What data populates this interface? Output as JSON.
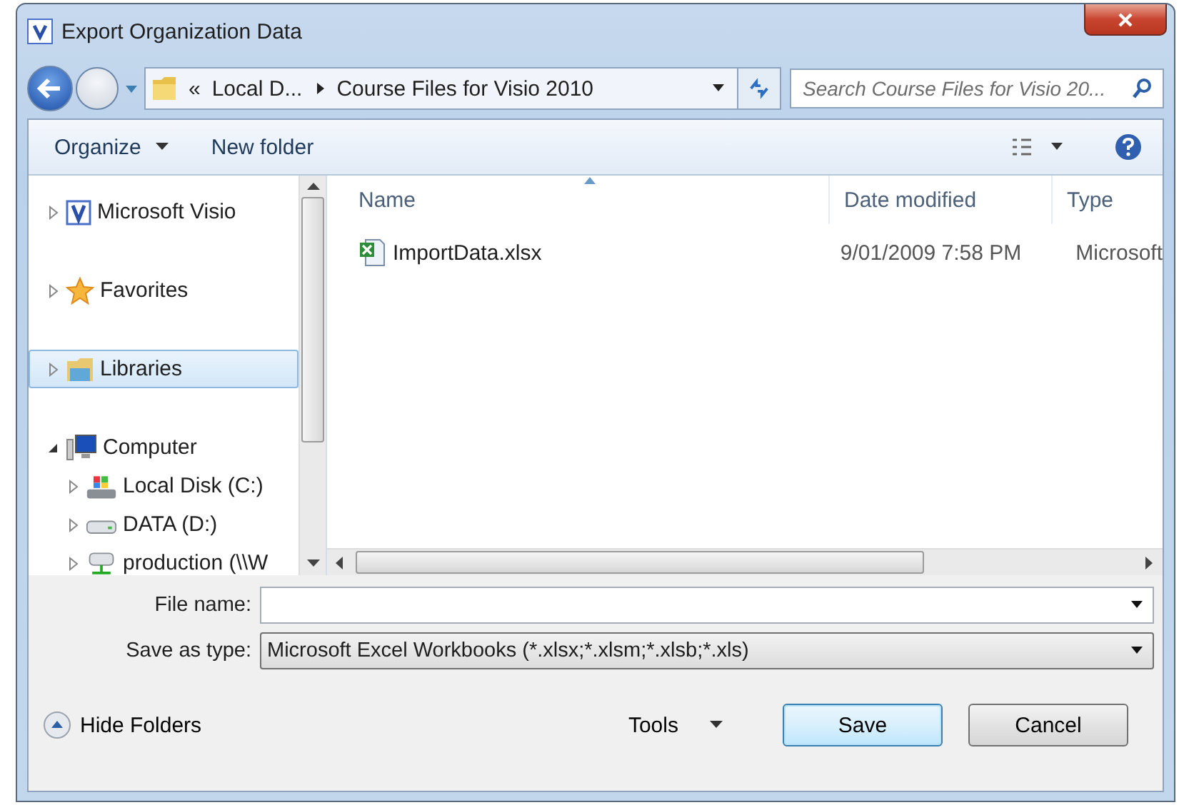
{
  "window": {
    "title": "Export Organization Data"
  },
  "address_bar": {
    "overflow": "«",
    "segments": [
      "Local D...",
      "Course Files for Visio 2010"
    ]
  },
  "search": {
    "placeholder": "Search Course Files for Visio 20..."
  },
  "toolbar": {
    "organize": "Organize",
    "new_folder": "New folder"
  },
  "sidebar": {
    "items": [
      {
        "label": "Microsoft Visio",
        "expanded": false,
        "selected": false
      },
      {
        "label": "Favorites",
        "expanded": false,
        "selected": false
      },
      {
        "label": "Libraries",
        "expanded": false,
        "selected": true
      },
      {
        "label": "Computer",
        "expanded": true,
        "selected": false,
        "children": [
          {
            "label": "Local Disk (C:)",
            "expanded": false,
            "selected": false
          },
          {
            "label": "DATA (D:)",
            "expanded": false,
            "selected": false
          },
          {
            "label": "production (\\\\W",
            "expanded": false,
            "selected": false
          }
        ]
      }
    ]
  },
  "table": {
    "columns": [
      "Name",
      "Date modified",
      "Type"
    ],
    "rows": [
      {
        "name": "ImportData.xlsx",
        "date": "9/01/2009 7:58 PM",
        "type": "Microsoft"
      }
    ]
  },
  "form": {
    "file_name_label": "File name:",
    "type_label": "Save as type:",
    "type_value": "Microsoft Excel Workbooks (*.xlsx;*.xlsm;*.xlsb;*.xls)"
  },
  "footer": {
    "hide_folders": "Hide Folders",
    "tools": "Tools",
    "save": "Save",
    "cancel": "Cancel"
  }
}
